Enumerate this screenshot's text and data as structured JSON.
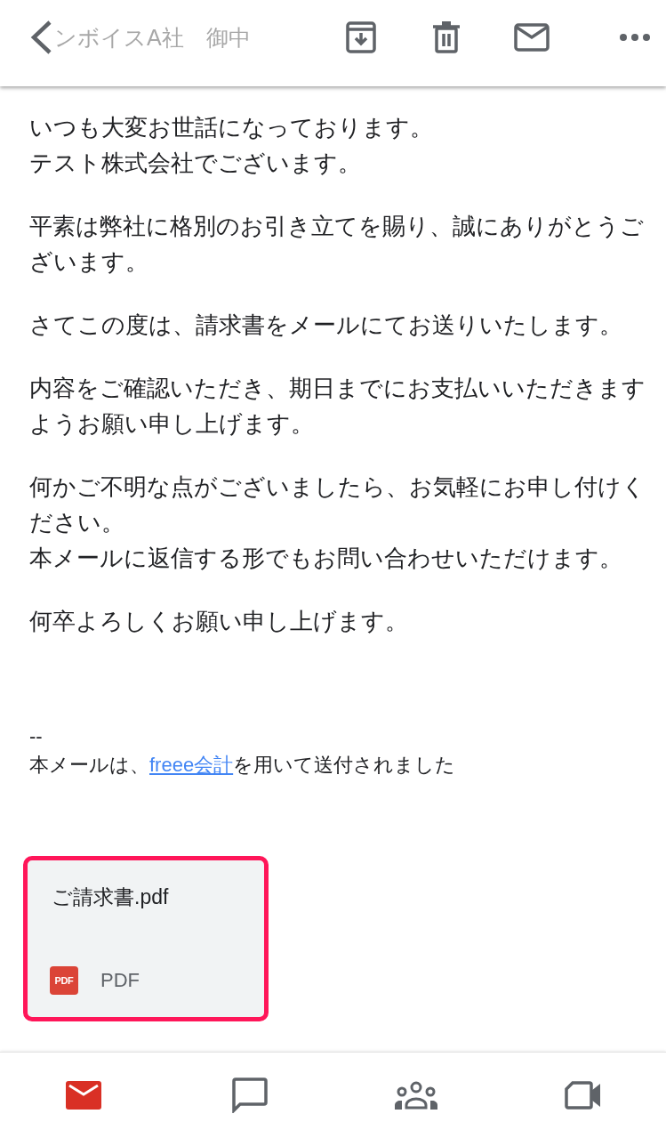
{
  "header": {
    "title": "ンボイスA社　御中"
  },
  "body": {
    "paragraphs": [
      [
        "いつも大変お世話になっております。",
        "テスト株式会社でございます。"
      ],
      [
        "平素は弊社に格別のお引き立てを賜り、誠にありがとうございます。"
      ],
      [
        "さてこの度は、請求書をメールにてお送りいたします。"
      ],
      [
        "内容をご確認いただき、期日までにお支払いいただきますようお願い申し上げます。"
      ],
      [
        "何かご不明な点がございましたら、お気軽にお申し付けください。",
        "本メールに返信する形でもお問い合わせいただけます。"
      ],
      [
        "何卒よろしくお願い申し上げます。"
      ]
    ]
  },
  "signature": {
    "separator": "--",
    "text_before": "本メールは、",
    "link": "freee会計",
    "text_after": "を用いて送付されました"
  },
  "attachment": {
    "name": "ご請求書.pdf",
    "badge": "PDF",
    "type": "PDF"
  },
  "nav": [
    {
      "kind": "mail",
      "selected": true
    },
    {
      "kind": "chat",
      "selected": false
    },
    {
      "kind": "rooms",
      "selected": false
    },
    {
      "kind": "meet",
      "selected": false
    }
  ]
}
